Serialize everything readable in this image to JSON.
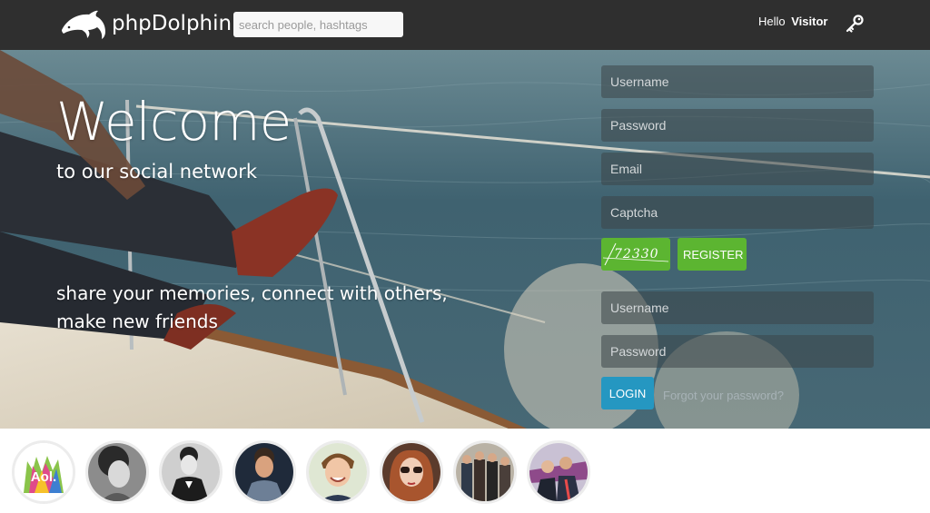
{
  "header": {
    "brand": "phpDolphin",
    "search_placeholder": "search people, hashtags",
    "greeting": "Hello",
    "user": "Visitor"
  },
  "hero": {
    "title": "Welcome",
    "subtitle": "to our social network",
    "tagline_line1": "share your memories, connect with others,",
    "tagline_line2": "make new friends"
  },
  "register_form": {
    "username_placeholder": "Username",
    "password_placeholder": "Password",
    "email_placeholder": "Email",
    "captcha_placeholder": "Captcha",
    "captcha_code": "72330",
    "register_label": "REGISTER"
  },
  "login_form": {
    "username_placeholder": "Username",
    "password_placeholder": "Password",
    "login_label": "LOGIN",
    "forgot_label": "Forgot your password?"
  },
  "avatars": [
    {
      "name": "avatar-aol"
    },
    {
      "name": "avatar-woman-bw"
    },
    {
      "name": "avatar-man-suit"
    },
    {
      "name": "avatar-man-dark"
    },
    {
      "name": "avatar-boy-smile"
    },
    {
      "name": "avatar-woman-glasses"
    },
    {
      "name": "avatar-band"
    },
    {
      "name": "avatar-group"
    }
  ],
  "colors": {
    "header_bg": "#2f2f2f",
    "green": "#5cb531",
    "blue": "#2597c1"
  }
}
